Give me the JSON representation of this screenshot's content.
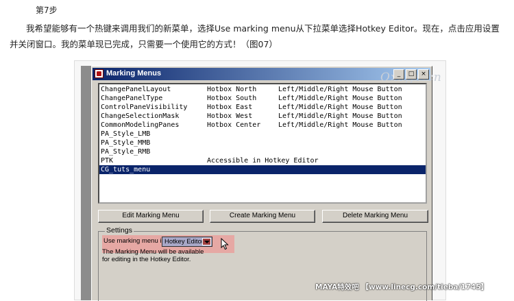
{
  "article": {
    "step_title": "第7步",
    "paragraph": "我希望能够有一个热键来调用我们的新菜单，选择Use marking menu从下拉菜单选择Hotkey Editor。现在，点击应用设置并关闭窗口。我的菜单现已完成，只需要一个使用它的方式！（图07）"
  },
  "window": {
    "title": "Marking Menus",
    "controls": {
      "minimize": "_",
      "maximize": "□",
      "close": "×"
    },
    "watermark": "Oxeffs.cn",
    "list": [
      {
        "name": "ChangePanelLayout",
        "location": "Hotbox North",
        "trigger": "Left/Middle/Right Mouse Button",
        "selected": false
      },
      {
        "name": "ChangePanelType",
        "location": "Hotbox South",
        "trigger": "Left/Middle/Right Mouse Button",
        "selected": false
      },
      {
        "name": "ControlPaneVisibility",
        "location": "Hotbox East",
        "trigger": "Left/Middle/Right Mouse Button",
        "selected": false
      },
      {
        "name": "ChangeSelectionMask",
        "location": "Hotbox West",
        "trigger": "Left/Middle/Right Mouse Button",
        "selected": false
      },
      {
        "name": "CommonModelingPanes",
        "location": "Hotbox Center",
        "trigger": "Left/Middle/Right Mouse Button",
        "selected": false
      },
      {
        "name": "PA_Style_LMB",
        "location": "",
        "trigger": "",
        "selected": false
      },
      {
        "name": "PA_Style_MMB",
        "location": "",
        "trigger": "",
        "selected": false
      },
      {
        "name": "PA_Style_RMB",
        "location": "",
        "trigger": "",
        "selected": false
      },
      {
        "name": "PTK",
        "location": "Accessible in Hotkey Editor",
        "trigger": "",
        "selected": false
      },
      {
        "name": "CG_tuts_menu",
        "location": "",
        "trigger": "",
        "selected": true
      }
    ],
    "buttons": {
      "edit": "Edit Marking Menu",
      "create": "Create Marking Menu",
      "delete": "Delete Marking Menu"
    },
    "settings": {
      "legend": "Settings",
      "use_label": "Use marking menu in:",
      "dropdown_value": "Hotkey Editor",
      "info_line1": "The Marking Menu will be available",
      "info_line2": "for editing in the Hotkey Editor."
    }
  },
  "credit": "MAYA特效吧 【www.linecg.com/tieba/1745】",
  "colors": {
    "selection": "#0a246a",
    "highlight": "#e6a8a4",
    "dialog_bg": "#d4d0c8"
  }
}
